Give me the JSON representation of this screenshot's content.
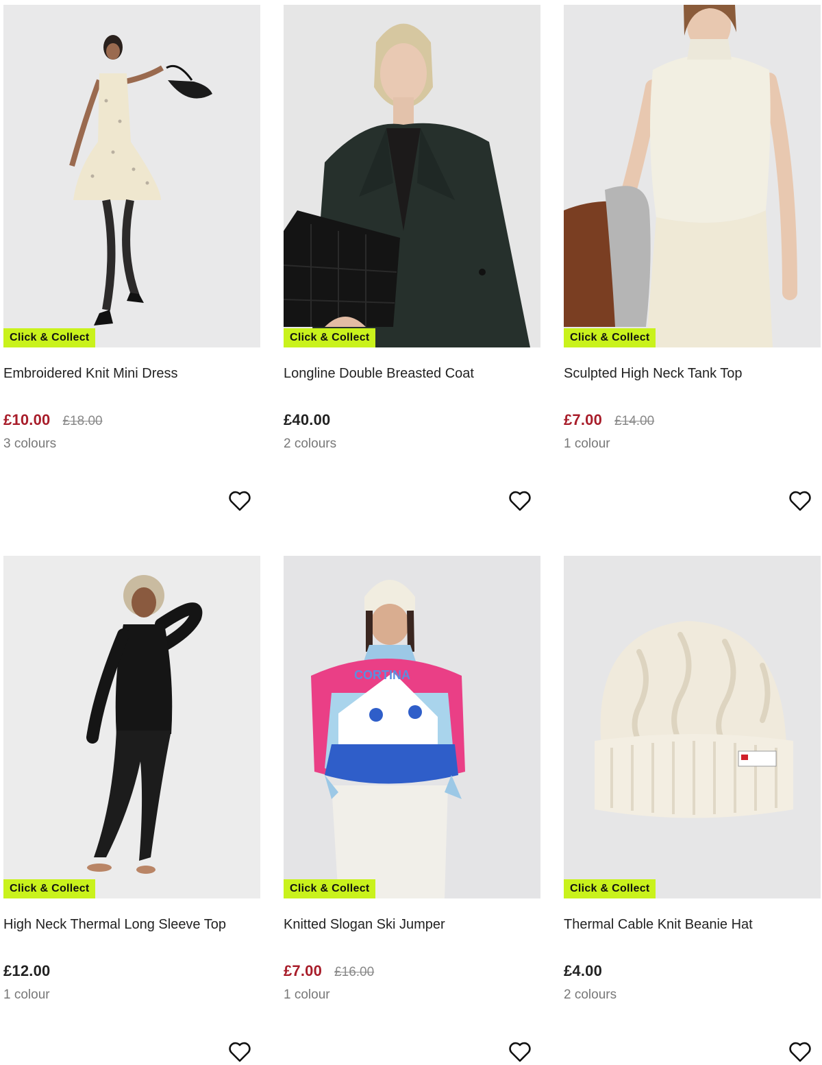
{
  "products": [
    {
      "badge": "Click & Collect",
      "name": "Embroidered Knit Mini Dress",
      "price": "£10.00",
      "was_price": "£18.00",
      "colours": "3 colours",
      "on_sale": true
    },
    {
      "badge": "Click & Collect",
      "name": "Longline Double Breasted Coat",
      "price": "£40.00",
      "was_price": "",
      "colours": "2 colours",
      "on_sale": false
    },
    {
      "badge": "Click & Collect",
      "name": "Sculpted High Neck Tank Top",
      "price": "£7.00",
      "was_price": "£14.00",
      "colours": "1 colour",
      "on_sale": true
    },
    {
      "badge": "Click & Collect",
      "name": "High Neck Thermal Long Sleeve Top",
      "price": "£12.00",
      "was_price": "",
      "colours": "1 colour",
      "on_sale": false
    },
    {
      "badge": "Click & Collect",
      "name": "Knitted Slogan Ski Jumper",
      "price": "£7.00",
      "was_price": "£16.00",
      "colours": "1 colour",
      "on_sale": true,
      "jumper_text": "CORTINA"
    },
    {
      "badge": "Click & Collect",
      "name": "Thermal Cable Knit Beanie Hat",
      "price": "£4.00",
      "was_price": "",
      "colours": "2 colours",
      "on_sale": false
    }
  ],
  "colors": {
    "badge_bg": "#c9f21c",
    "sale_price": "#a81d2a",
    "was_price": "#888888"
  },
  "icons": {
    "wishlist": "heart-outline-icon"
  }
}
